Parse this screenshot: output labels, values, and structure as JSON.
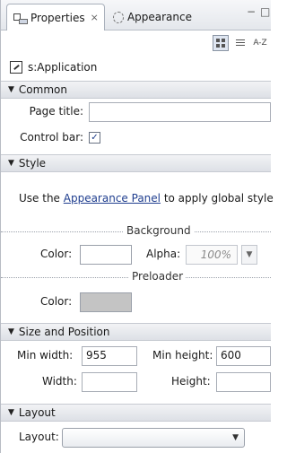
{
  "tabs": [
    {
      "label": "Properties",
      "close": "⨯"
    },
    {
      "label": "Appearance"
    }
  ],
  "window_controls": {
    "minimize": "−",
    "maximize": "□"
  },
  "toolbar": {
    "category_view": "category-view",
    "list_view": "list-view",
    "sort": "A-Z"
  },
  "component": {
    "name": "s:Application"
  },
  "sections": {
    "common": "Common",
    "style": "Style",
    "size_position": "Size and Position",
    "layout": "Layout"
  },
  "common": {
    "page_title_label": "Page title:",
    "page_title_value": "",
    "control_bar_label": "Control bar:",
    "control_bar_checked": true,
    "checkmark": "✓"
  },
  "style": {
    "note_prefix": "Use the ",
    "note_link": "Appearance Panel",
    "note_suffix": " to apply global style",
    "background_label": "Background",
    "color_label": "Color:",
    "alpha_label": "Alpha:",
    "alpha_value": "100%",
    "preloader_label": "Preloader",
    "preloader_color_label": "Color:",
    "background_color": "#ffffff",
    "preloader_color": "#c4c4c4"
  },
  "size": {
    "min_width_label": "Min width:",
    "min_width_value": "955",
    "min_height_label": "Min height:",
    "min_height_value": "600",
    "width_label": "Width:",
    "width_value": "",
    "height_label": "Height:",
    "height_value": ""
  },
  "layout": {
    "layout_label": "Layout:",
    "layout_value": ""
  }
}
